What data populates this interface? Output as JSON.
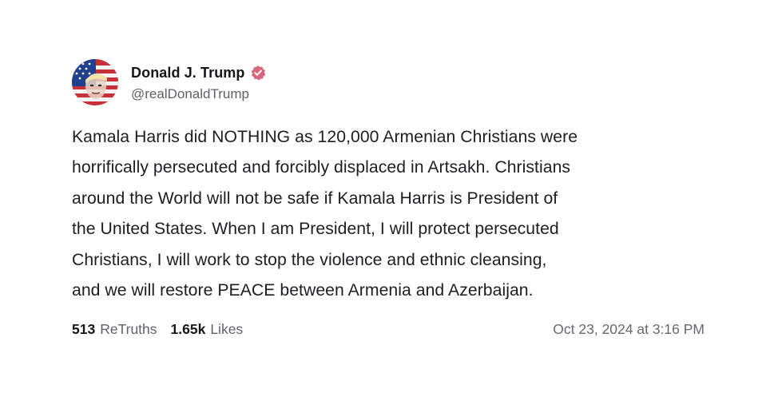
{
  "post": {
    "author": {
      "display_name": "Donald J. Trump",
      "handle": "@realDonaldTrump",
      "verified_icon": "verified-badge-icon",
      "avatar_icon": "flag-portrait-avatar"
    },
    "text": "Kamala Harris did NOTHING as 120,000 Armenian Christians were\nhorrifically persecuted and forcibly displaced in Artsakh. Christians\naround the World will not be safe if Kamala Harris is President of\nthe United States. When I am President, I will protect persecuted\nChristians, I will work to stop the violence and ethnic cleansing,\nand we will restore PEACE between Armenia and Azerbaijan.",
    "stats": {
      "retruths_count": "513",
      "retruths_label": "ReTruths",
      "likes_count": "1.65k",
      "likes_label": "Likes"
    },
    "timestamp": "Oct 23, 2024 at 3:16 PM"
  },
  "colors": {
    "verified_badge": "#d9677c",
    "text_primary": "#1d1e22",
    "text_secondary": "#606269"
  }
}
